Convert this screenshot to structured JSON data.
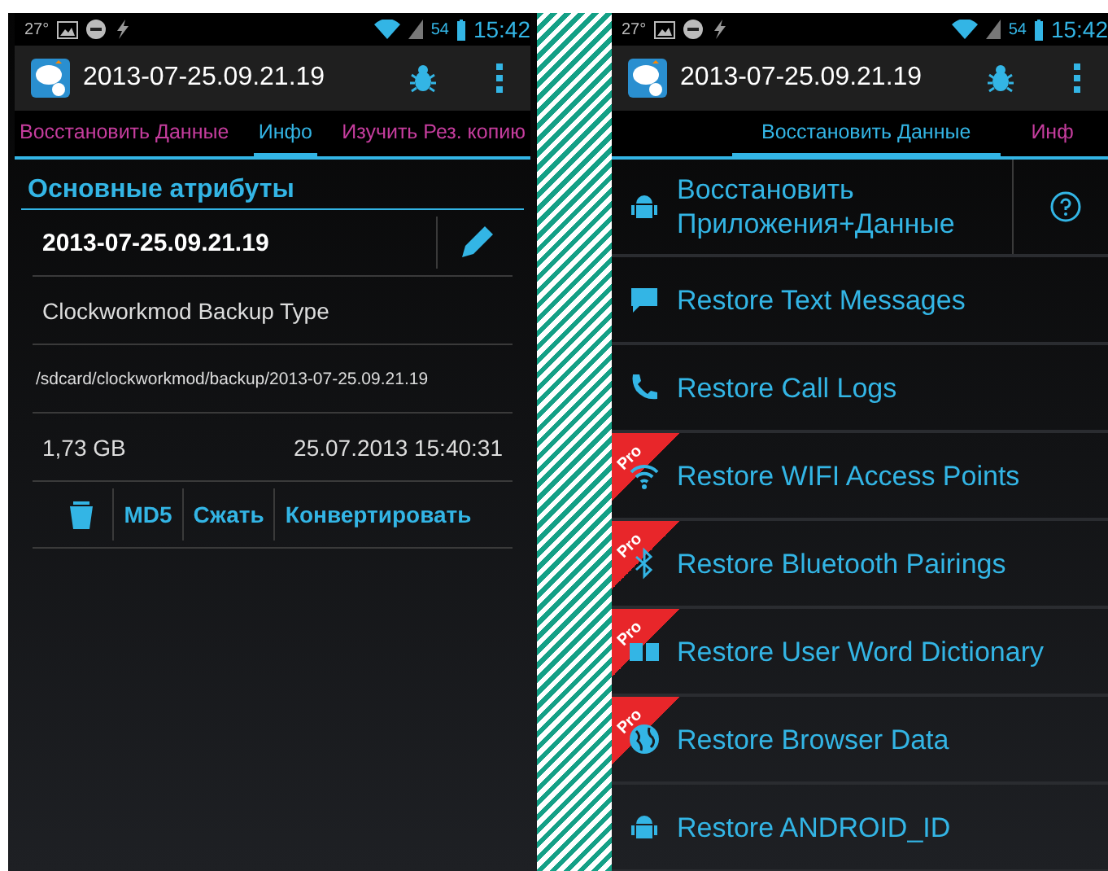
{
  "screens": [
    {
      "kind": "info",
      "status_bar": {
        "temperature": "27°",
        "battery": "54",
        "time": "15:42"
      },
      "app_bar": {
        "title": "2013-07-25.09.21.19"
      },
      "tabs": [
        {
          "label": "Восстановить Данные",
          "selected": false
        },
        {
          "label": "Инфо",
          "selected": true
        },
        {
          "label": "Изучить Рез. копию",
          "selected": false
        }
      ],
      "section_title": "Основные атрибуты",
      "name": "2013-07-25.09.21.19",
      "type": "Clockworkmod Backup Type",
      "path": "/sdcard/clockworkmod/backup/2013-07-25.09.21.19",
      "size": "1,73 GB",
      "date": "25.07.2013 15:40:31",
      "actions": [
        "MD5",
        "Сжать",
        "Конвертировать"
      ]
    },
    {
      "kind": "restore",
      "status_bar": {
        "temperature": "27°",
        "battery": "54",
        "time": "15:42"
      },
      "app_bar": {
        "title": "2013-07-25.09.21.19"
      },
      "tabs": [
        {
          "label": "Восстановить Данные",
          "selected": true
        },
        {
          "label": "Инф",
          "selected": false
        }
      ],
      "items": [
        {
          "label": "Восстановить Приложения+Данные",
          "kind": "android",
          "help": true
        },
        {
          "label": "Restore Text Messages",
          "kind": "message",
          "help": false
        },
        {
          "label": "Restore Call Logs",
          "kind": "phone",
          "help": false
        },
        {
          "label": "Restore WIFI Access Points",
          "kind": "wifi",
          "badge": "Pro",
          "help": false
        },
        {
          "label": "Restore Bluetooth Pairings",
          "kind": "bluetooth",
          "badge": "Pro",
          "help": false
        },
        {
          "label": "Restore User Word Dictionary",
          "kind": "book",
          "badge": "Pro",
          "help": false
        },
        {
          "label": "Restore Browser Data",
          "kind": "globe",
          "badge": "Pro",
          "help": false
        },
        {
          "label": "Restore ANDROID_ID",
          "kind": "android",
          "help": false
        }
      ]
    }
  ]
}
